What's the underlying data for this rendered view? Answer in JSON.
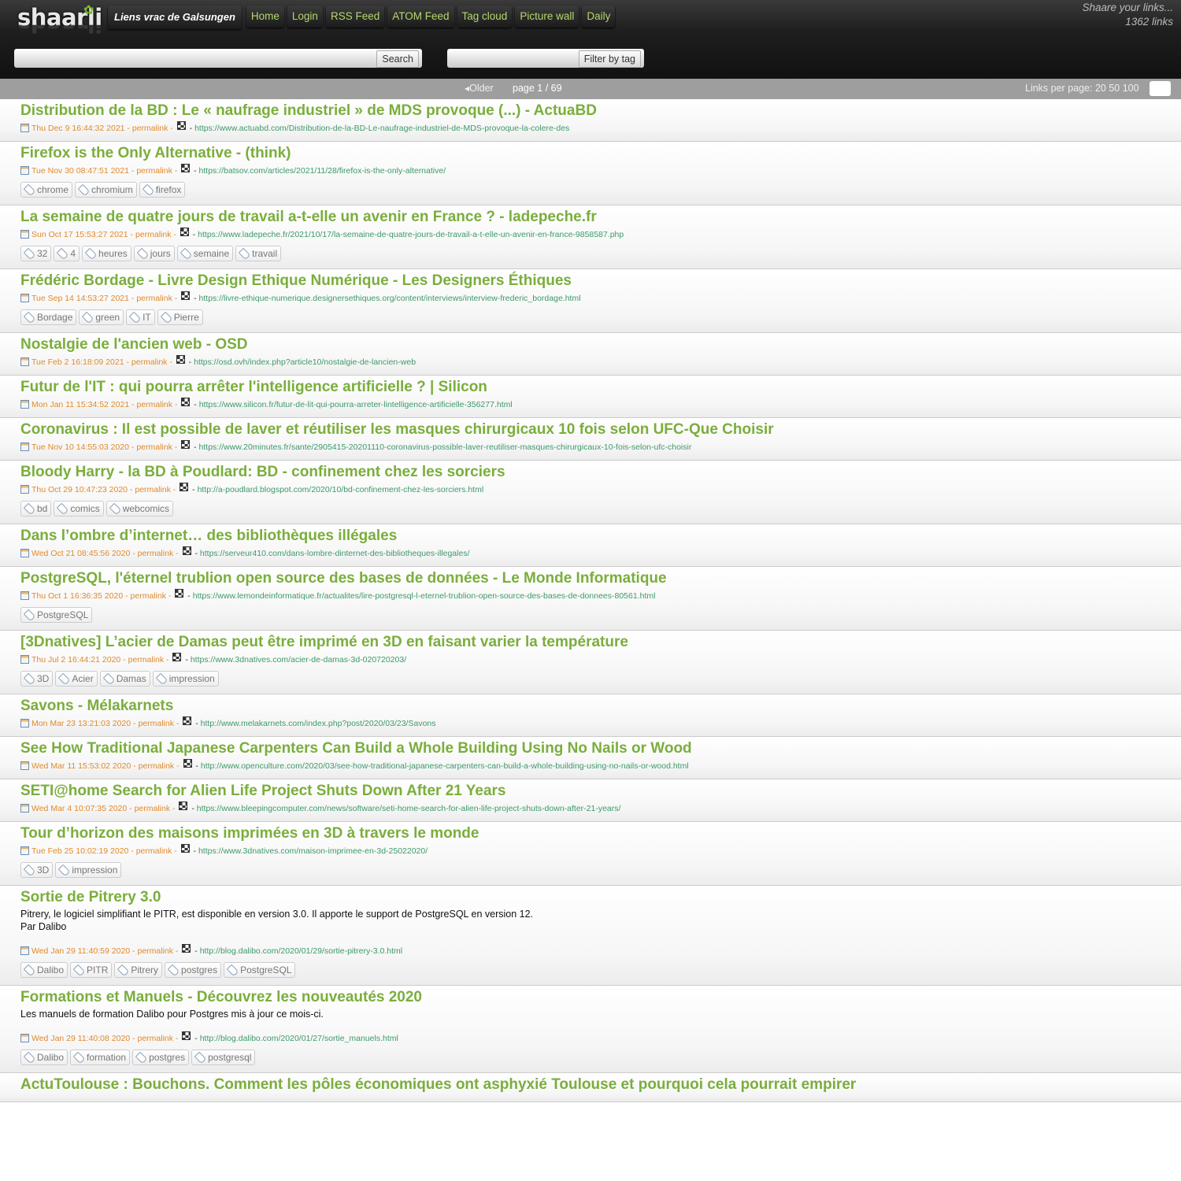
{
  "header": {
    "logo_text": "shaarli",
    "site_title": "Liens vrac de Galsungen",
    "nav": [
      "Home",
      "Login",
      "RSS Feed",
      "ATOM Feed",
      "Tag cloud",
      "Picture wall",
      "Daily"
    ],
    "tagline": "Shaare your links...",
    "link_count": "1362 links",
    "search_button": "Search",
    "search_value": "",
    "filter_button": "Filter by tag",
    "filter_value": ""
  },
  "paging": {
    "older": "Older",
    "page": "page 1 / 69",
    "links_per_page_label": "Links per page: 20 50 100"
  },
  "links": [
    {
      "title": "Distribution de la BD : Le « naufrage industriel » de MDS provoque (...) - ActuaBD",
      "date": "Thu Dec 9 16:44:32 2021",
      "permalink": "permalink",
      "url": "https://www.actuabd.com/Distribution-de-la-BD-Le-naufrage-industriel-de-MDS-provoque-la-colere-des",
      "desc": [],
      "tags": []
    },
    {
      "title": "Firefox is the Only Alternative - (think)",
      "date": "Tue Nov 30 08:47:51 2021",
      "permalink": "permalink",
      "url": "https://batsov.com/articles/2021/11/28/firefox-is-the-only-alternative/",
      "desc": [],
      "tags": [
        "chrome",
        "chromium",
        "firefox"
      ]
    },
    {
      "title": "La semaine de quatre jours de travail a-t-elle un avenir en France ? - ladepeche.fr",
      "date": "Sun Oct 17 15:53:27 2021",
      "permalink": "permalink",
      "url": "https://www.ladepeche.fr/2021/10/17/la-semaine-de-quatre-jours-de-travail-a-t-elle-un-avenir-en-france-9858587.php",
      "desc": [],
      "tags": [
        "32",
        "4",
        "heures",
        "jours",
        "semaine",
        "travail"
      ]
    },
    {
      "title": "Frédéric Bordage - Livre Design Ethique Numérique - Les Designers Éthiques",
      "date": "Tue Sep 14 14:53:27 2021",
      "permalink": "permalink",
      "url": "https://livre-ethique-numerique.designersethiques.org/content/interviews/interview-frederic_bordage.html",
      "desc": [],
      "tags": [
        "Bordage",
        "green",
        "IT",
        "Pierre"
      ]
    },
    {
      "title": "Nostalgie de l'ancien web - OSD",
      "date": "Tue Feb 2 16:18:09 2021",
      "permalink": "permalink",
      "url": "https://osd.ovh/index.php?article10/nostalgie-de-lancien-web",
      "desc": [],
      "tags": []
    },
    {
      "title": "Futur de l'IT : qui pourra arrêter l'intelligence artificielle ? | Silicon",
      "date": "Mon Jan 11 15:34:52 2021",
      "permalink": "permalink",
      "url": "https://www.silicon.fr/futur-de-lit-qui-pourra-arreter-lintelligence-artificielle-356277.html",
      "desc": [],
      "tags": []
    },
    {
      "title": "Coronavirus : Il est possible de laver et réutiliser les masques chirurgicaux 10 fois selon UFC-Que Choisir",
      "date": "Tue Nov 10 14:55:03 2020",
      "permalink": "permalink",
      "url": "https://www.20minutes.fr/sante/2905415-20201110-coronavirus-possible-laver-reutiliser-masques-chirurgicaux-10-fois-selon-ufc-choisir",
      "desc": [],
      "tags": []
    },
    {
      "title": "Bloody Harry - la BD à Poudlard: BD - confinement chez les sorciers",
      "date": "Thu Oct 29 10:47:23 2020",
      "permalink": "permalink",
      "url": "http://a-poudlard.blogspot.com/2020/10/bd-confinement-chez-les-sorciers.html",
      "desc": [],
      "tags": [
        "bd",
        "comics",
        "webcomics"
      ]
    },
    {
      "title": "Dans l’ombre d’internet… des bibliothèques illégales",
      "date": "Wed Oct 21 08:45:56 2020",
      "permalink": "permalink",
      "url": "https://serveur410.com/dans-lombre-dinternet-des-bibliotheques-illegales/",
      "desc": [],
      "tags": []
    },
    {
      "title": "PostgreSQL, l'éternel trublion open source des bases de données - Le Monde Informatique",
      "date": "Thu Oct 1 16:36:35 2020",
      "permalink": "permalink",
      "url": "https://www.lemondeinformatique.fr/actualites/lire-postgresql-l-eternel-trublion-open-source-des-bases-de-donnees-80561.html",
      "desc": [],
      "tags": [
        "PostgreSQL"
      ]
    },
    {
      "title": "[3Dnatives] L’acier de Damas peut être imprimé en 3D en faisant varier la température",
      "date": "Thu Jul 2 16:44:21 2020",
      "permalink": "permalink",
      "url": "https://www.3dnatives.com/acier-de-damas-3d-020720203/",
      "desc": [],
      "tags": [
        "3D",
        "Acier",
        "Damas",
        "impression"
      ]
    },
    {
      "title": "Savons - Mélakarnets",
      "date": "Mon Mar 23 13:21:03 2020",
      "permalink": "permalink",
      "url": "http://www.melakarnets.com/index.php?post/2020/03/23/Savons",
      "desc": [],
      "tags": []
    },
    {
      "title": "See How Traditional Japanese Carpenters Can Build a Whole Building Using No Nails or Wood",
      "date": "Wed Mar 11 15:53:02 2020",
      "permalink": "permalink",
      "url": "http://www.openculture.com/2020/03/see-how-traditional-japanese-carpenters-can-build-a-whole-building-using-no-nails-or-wood.html",
      "desc": [],
      "tags": []
    },
    {
      "title": "SETI@home Search for Alien Life Project Shuts Down After 21 Years",
      "date": "Wed Mar 4 10:07:35 2020",
      "permalink": "permalink",
      "url": "https://www.bleepingcomputer.com/news/software/seti-home-search-for-alien-life-project-shuts-down-after-21-years/",
      "desc": [],
      "tags": []
    },
    {
      "title": "Tour d’horizon des maisons imprimées en 3D à travers le monde",
      "date": "Tue Feb 25 10:02:19 2020",
      "permalink": "permalink",
      "url": "https://www.3dnatives.com/maison-imprimee-en-3d-25022020/",
      "desc": [],
      "tags": [
        "3D",
        "impression"
      ]
    },
    {
      "title": "Sortie de Pitrery 3.0",
      "date": "Wed Jan 29 11:40:59 2020",
      "permalink": "permalink",
      "url": "http://blog.dalibo.com/2020/01/29/sortie-pitrery-3.0.html",
      "desc": [
        "Pitrery, le logiciel simplifiant le PITR, est disponible en version 3.0. Il apporte le support de PostgreSQL en version 12.",
        "Par Dalibo"
      ],
      "tags": [
        "Dalibo",
        "PITR",
        "Pitrery",
        "postgres",
        "PostgreSQL"
      ]
    },
    {
      "title": "Formations et Manuels - Découvrez les nouveautés 2020",
      "date": "Wed Jan 29 11:40:08 2020",
      "permalink": "permalink",
      "url": "http://blog.dalibo.com/2020/01/27/sortie_manuels.html",
      "desc": [
        "Les manuels de formation Dalibo pour Postgres mis à jour ce mois-ci."
      ],
      "tags": [
        "Dalibo",
        "formation",
        "postgres",
        "postgresql"
      ]
    },
    {
      "title": "ActuToulouse : Bouchons. Comment les pôles économiques ont asphyxié Toulouse et pourquoi cela pourrait empirer",
      "date": "",
      "permalink": "",
      "url": "",
      "desc": [],
      "tags": []
    }
  ]
}
